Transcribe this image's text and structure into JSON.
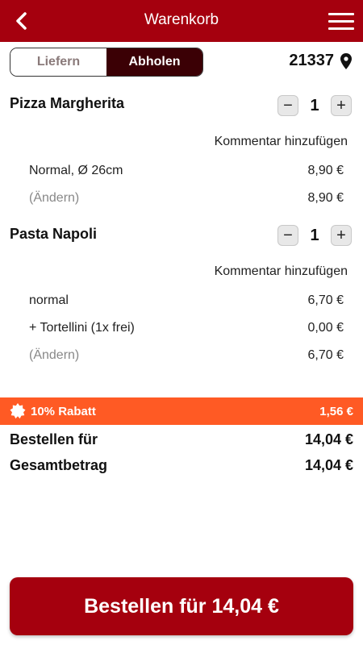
{
  "header": {
    "title": "Warenkorb"
  },
  "delivery": {
    "option_delivery": "Liefern",
    "option_pickup": "Abholen",
    "selected": "Abholen",
    "postal_code": "21337"
  },
  "items": [
    {
      "name": "Pizza Margherita",
      "quantity": "1",
      "comment_label": "Kommentar hinzufügen",
      "lines": [
        {
          "label": "Normal, Ø 26cm",
          "price": "8,90 €"
        },
        {
          "label": "(Ändern)",
          "price": "8,90 €"
        }
      ]
    },
    {
      "name": "Pasta Napoli",
      "quantity": "1",
      "comment_label": "Kommentar hinzufügen",
      "lines": [
        {
          "label": "normal",
          "price": "6,70 €"
        },
        {
          "label": "+ Tortellini (1x frei)",
          "price": "0,00 €"
        },
        {
          "label": "(Ändern)",
          "price": "6,70 €"
        }
      ]
    }
  ],
  "stepper": {
    "minus": "−",
    "plus": "+"
  },
  "discount": {
    "label": "10% Rabatt",
    "amount": "1,56 €"
  },
  "totals": {
    "order_for_label": "Bestellen für",
    "order_for_value": "14,04 €",
    "total_label": "Gesamtbetrag",
    "total_value": "14,04 €"
  },
  "order_button": {
    "label": "Bestellen für 14,04 €"
  },
  "colors": {
    "brand": "#a5000e",
    "discount": "#ff5a24",
    "toggle_active": "#3b0005"
  }
}
